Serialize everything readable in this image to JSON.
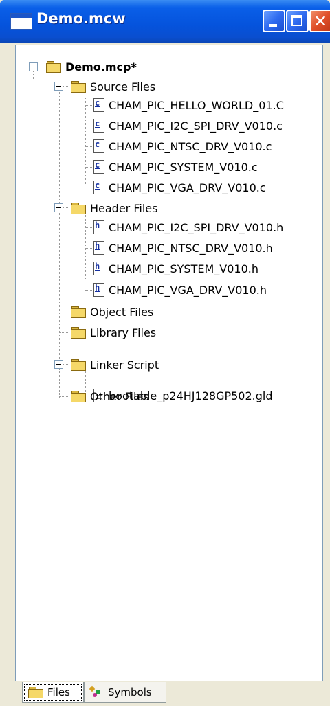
{
  "window": {
    "title": "Demo.mcw"
  },
  "tree": {
    "project": "Demo.mcp*",
    "source_folder": "Source Files",
    "source_files": [
      "CHAM_PIC_HELLO_WORLD_01.C",
      "CHAM_PIC_I2C_SPI_DRV_V010.c",
      "CHAM_PIC_NTSC_DRV_V010.c",
      "CHAM_PIC_SYSTEM_V010.c",
      "CHAM_PIC_VGA_DRV_V010.c"
    ],
    "header_folder": "Header Files",
    "header_files": [
      "CHAM_PIC_I2C_SPI_DRV_V010.h",
      "CHAM_PIC_NTSC_DRV_V010.h",
      "CHAM_PIC_SYSTEM_V010.h",
      "CHAM_PIC_VGA_DRV_V010.h"
    ],
    "object_folder": "Object Files",
    "library_folder": "Library Files",
    "linker_folder": "Linker Script",
    "linker_file": "bootable_p24HJ128GP502.gld",
    "other_folder": "Other Files"
  },
  "tabs": {
    "files": "Files",
    "symbols": "Symbols"
  },
  "icons": {
    "source": "c-file-icon",
    "header": "h-file-icon",
    "folder": "folder-icon",
    "linker": "document-icon"
  }
}
